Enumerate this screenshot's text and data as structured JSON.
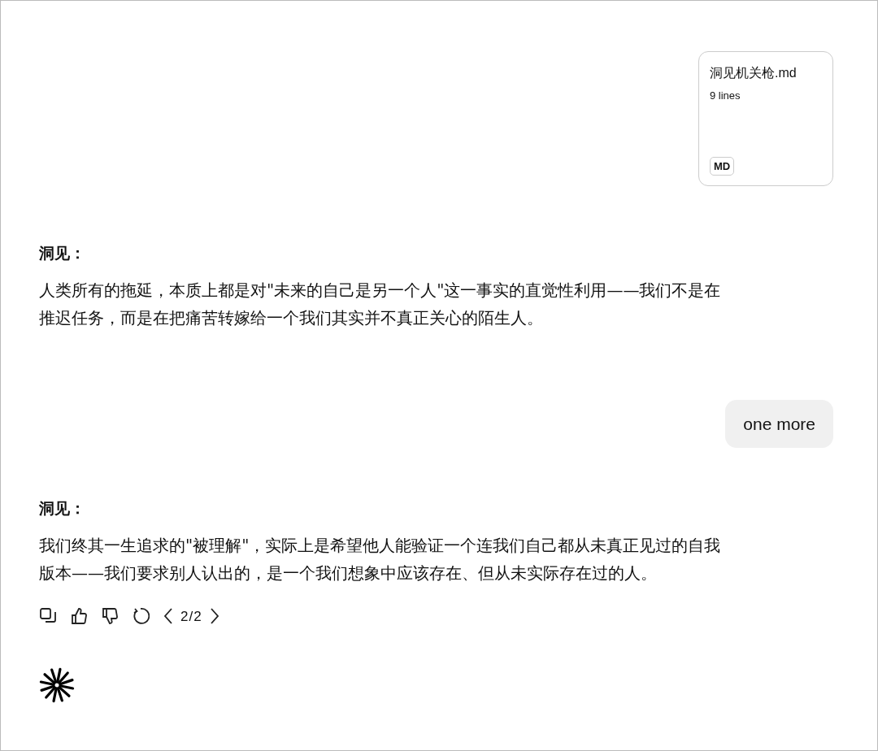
{
  "attachment": {
    "filename": "洞见机关枪.md",
    "line_count": "9 lines",
    "badge": "MD"
  },
  "messages": [
    {
      "kind": "assistant",
      "speaker": "洞见：",
      "lines": [
        "人类所有的拖延，本质上都是对\"未来的自己是另一个人\"这一事实的直觉性利用——我们不是在",
        "推迟任务，而是在把痛苦转嫁给一个我们其实并不真正关心的陌生人。"
      ]
    },
    {
      "kind": "user",
      "text": "one more"
    },
    {
      "kind": "assistant",
      "speaker": "洞见：",
      "lines": [
        "我们终其一生追求的\"被理解\"，实际上是希望他人能验证一个连我们自己都从未真正见过的自我",
        "版本——我们要求别人认出的，是一个我们想象中应该存在、但从未实际存在过的人。"
      ]
    }
  ],
  "actions": {
    "pager": "2/2"
  }
}
